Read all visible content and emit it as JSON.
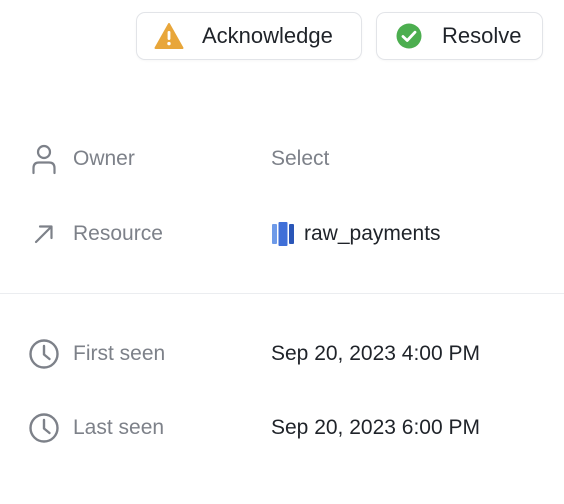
{
  "actions": {
    "acknowledge_label": "Acknowledge",
    "resolve_label": "Resolve",
    "acknowledge_icon": "warning-icon",
    "resolve_icon": "check-circle-icon"
  },
  "properties": {
    "owner": {
      "label": "Owner",
      "value": "Select",
      "icon": "user-icon"
    },
    "resource": {
      "label": "Resource",
      "value": "raw_payments",
      "icon": "arrow-up-right-icon",
      "value_icon": "database-table-icon"
    },
    "first_seen": {
      "label": "First seen",
      "value": "Sep 20, 2023 4:00 PM",
      "icon": "clock-icon"
    },
    "last_seen": {
      "label": "Last seen",
      "value": "Sep 20, 2023 6:00 PM",
      "icon": "clock-icon"
    }
  },
  "colors": {
    "warning": "#e8a63a",
    "success": "#4cae4f",
    "resource_blue": "#3f6fd8",
    "label_gray": "#7d8189",
    "text_dark": "#1f2329"
  }
}
